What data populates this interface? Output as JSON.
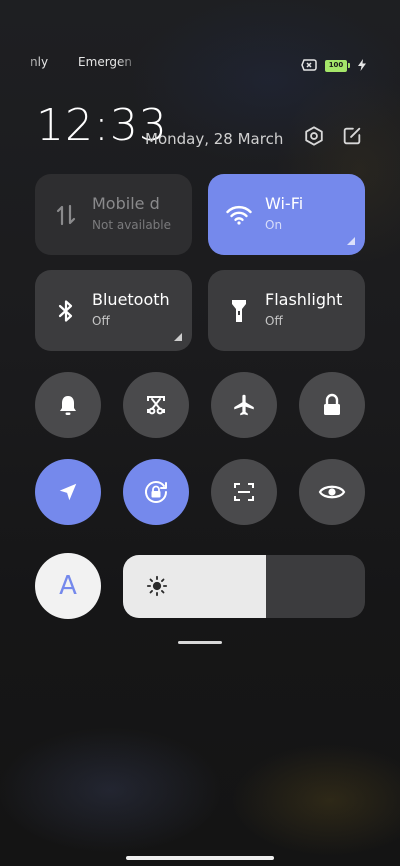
{
  "status_bar": {
    "left_items": [
      "nly",
      "Emergen"
    ],
    "battery_level": "100",
    "icons": [
      "sim-missing-icon",
      "battery-icon",
      "charging-bolt-icon"
    ]
  },
  "header": {
    "time": "12:33",
    "date": "Monday, 28 March",
    "buttons": [
      "settings-icon",
      "edit-icon"
    ]
  },
  "tiles": {
    "mobile_data": {
      "title": "Mobile d",
      "subtitle": "Not available",
      "state": "disabled",
      "icon": "mobile-data-icon"
    },
    "wifi": {
      "title": "Wi-Fi",
      "subtitle": "On",
      "state": "on",
      "icon": "wifi-icon"
    },
    "bluetooth": {
      "title": "Bluetooth",
      "subtitle": "Off",
      "state": "off",
      "icon": "bluetooth-icon"
    },
    "flashlight": {
      "title": "Flashlight",
      "subtitle": "Off",
      "state": "off",
      "icon": "flashlight-icon"
    }
  },
  "toggles_row1": [
    {
      "name": "notifications",
      "icon": "bell-icon",
      "state": "off"
    },
    {
      "name": "screenshot",
      "icon": "scissors-screenshot-icon",
      "state": "off"
    },
    {
      "name": "airplane-mode",
      "icon": "airplane-icon",
      "state": "off"
    },
    {
      "name": "lock-screen",
      "icon": "lock-icon",
      "state": "off"
    }
  ],
  "toggles_row2": [
    {
      "name": "location",
      "icon": "navigation-arrow-icon",
      "state": "on"
    },
    {
      "name": "rotation-lock",
      "icon": "rotation-lock-icon",
      "state": "on"
    },
    {
      "name": "scanner",
      "icon": "scan-icon",
      "state": "off"
    },
    {
      "name": "reading-mode",
      "icon": "eye-icon",
      "state": "off"
    }
  ],
  "auto_brightness": {
    "label": "A",
    "state": "on"
  },
  "brightness": {
    "level": 0.59,
    "icon": "sun-icon"
  },
  "colors": {
    "accent": "#7589ec",
    "tile_off": "#3c3c3e",
    "round_off": "#4a4a4c",
    "battery_green": "#a5e66a"
  }
}
